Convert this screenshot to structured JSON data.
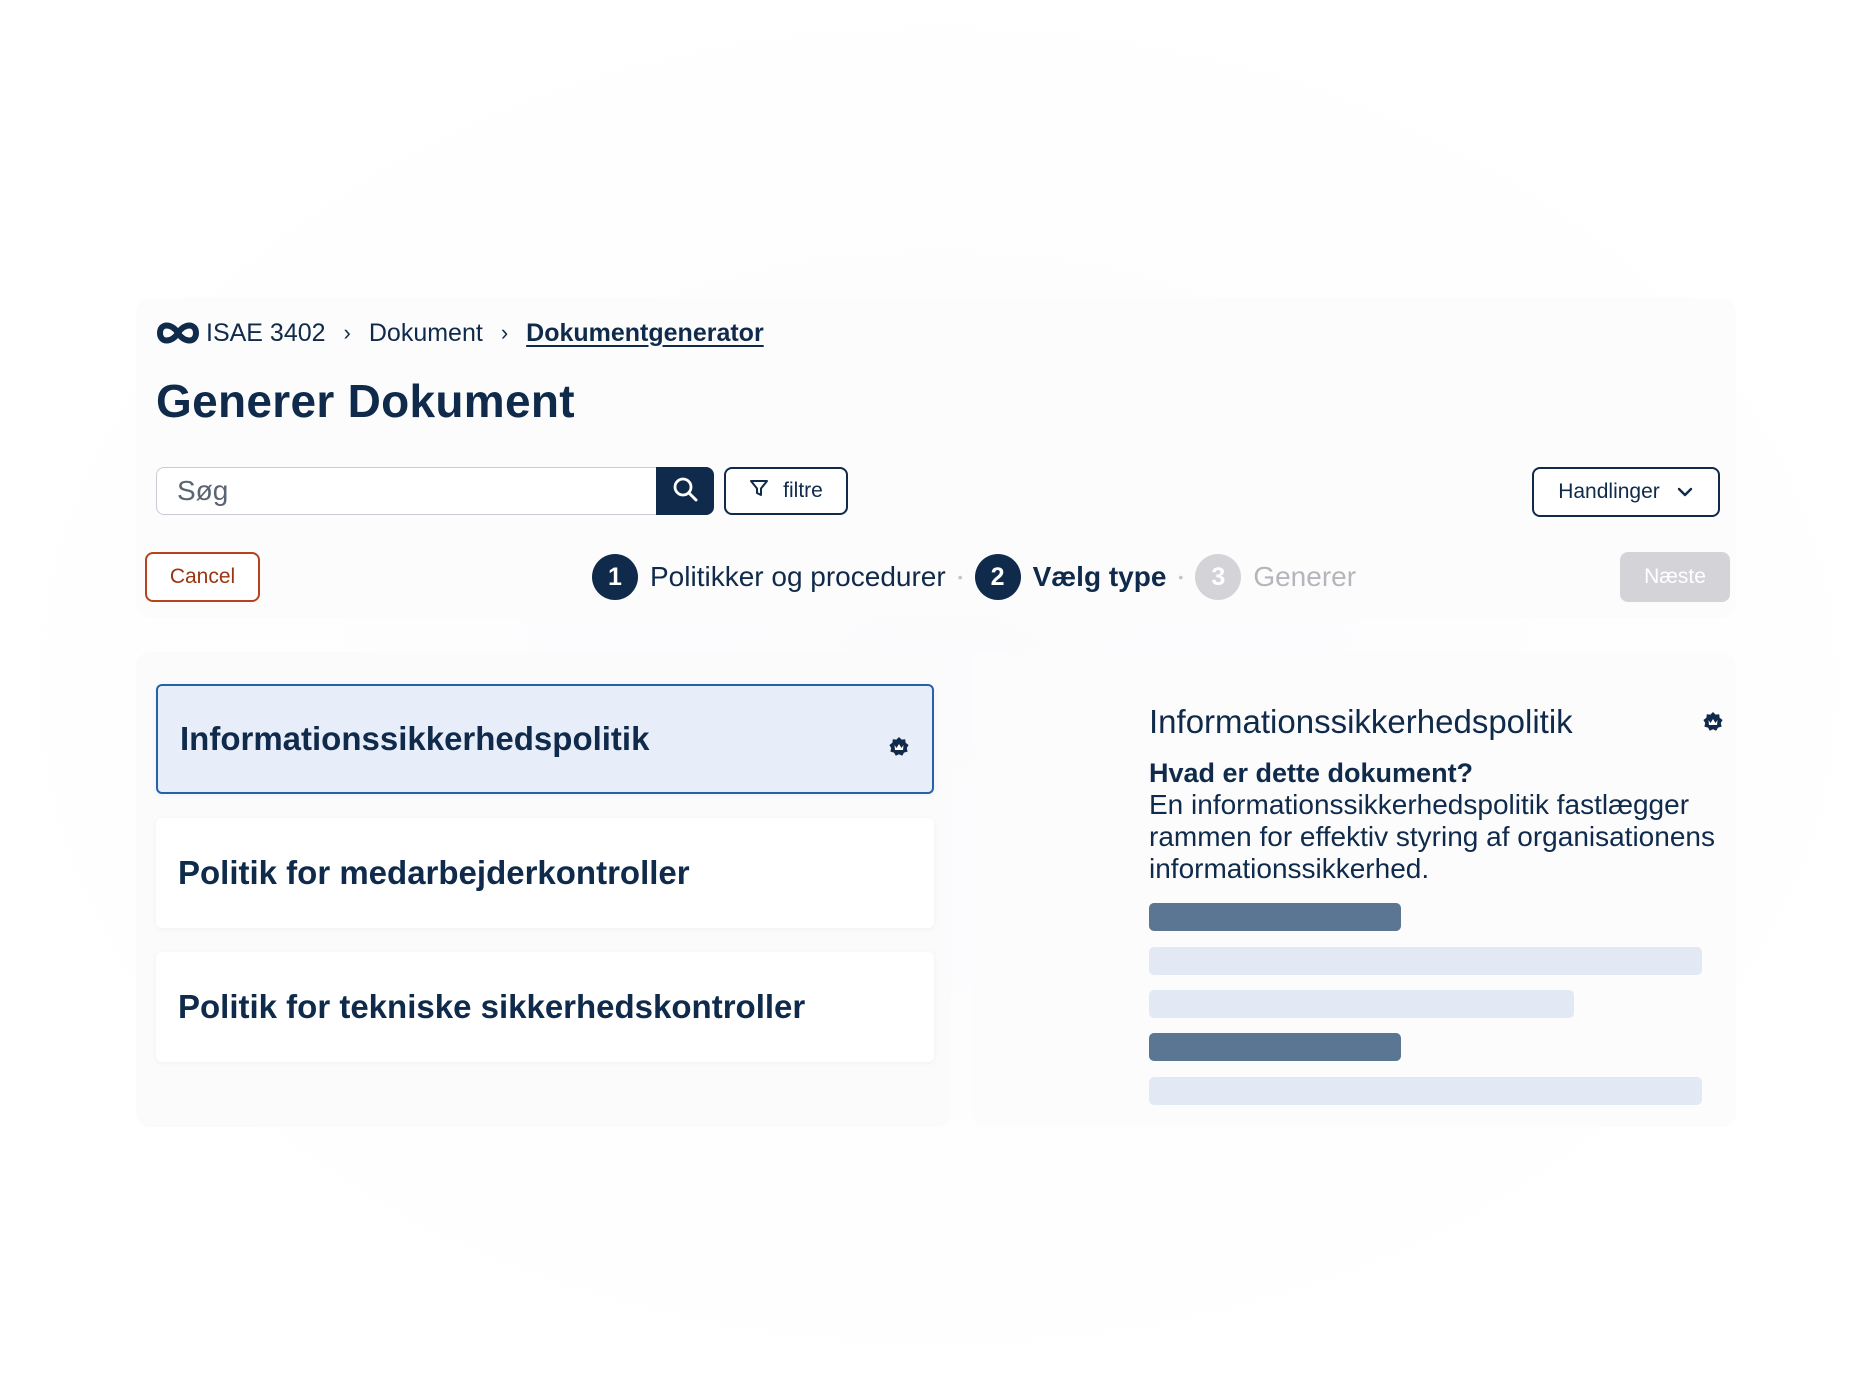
{
  "breadcrumb": {
    "root": "ISAE 3402",
    "level2": "Dokument",
    "current": "Dokumentgenerator"
  },
  "page": {
    "title": "Generer Dokument"
  },
  "search": {
    "placeholder": "Søg",
    "icon": "search-icon"
  },
  "toolbar": {
    "filter_label": "filtre",
    "actions_label": "Handlinger"
  },
  "wizard": {
    "cancel_label": "Cancel",
    "next_label": "Næste",
    "steps": [
      {
        "number": "1",
        "label": "Politikker og procedurer",
        "state": "completed"
      },
      {
        "number": "2",
        "label": "Vælg type",
        "state": "active"
      },
      {
        "number": "3",
        "label": "Generer",
        "state": "disabled"
      }
    ]
  },
  "documents": [
    {
      "label": "Informationssikkerhedspolitik",
      "selected": true,
      "badge": "verified-badge-icon"
    },
    {
      "label": "Politik for medarbejderkontroller",
      "selected": false
    },
    {
      "label": "Politik for tekniske sikkerhedskontroller",
      "selected": false
    }
  ],
  "detail": {
    "title": "Informationssikkerhedspolitik",
    "subheading": "Hvad er dette dokument?",
    "description": "En informationssikkerhedspolitik fastlægger rammen for effektiv styring af organisationens informationssikkerhed."
  },
  "colors": {
    "primary": "#0f2a4a",
    "selected_border": "#2563a8",
    "selected_bg": "#e8eef9",
    "cancel": "#b6431e",
    "disabled": "#d4d4d8",
    "skeleton_dark": "#5a7692",
    "skeleton_light": "#e3e9f4"
  }
}
